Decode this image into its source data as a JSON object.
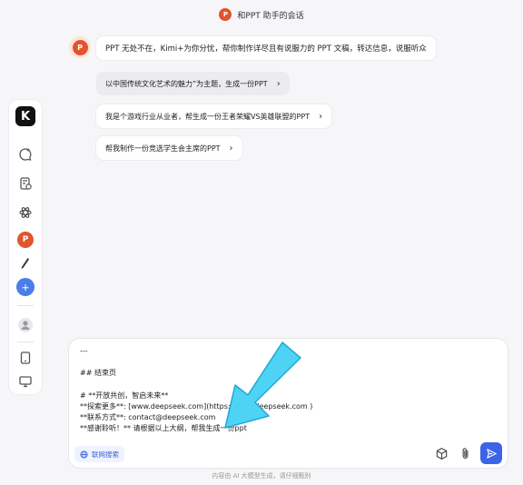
{
  "header": {
    "icon": "ppt-icon",
    "title": "和PPT 助手的会话"
  },
  "assistant": {
    "avatar_label": "P",
    "greeting": "PPT 无处不在，Kimi+为你分忧，帮你制作详尽且有说服力的 PPT 文稿，转达信息，说服听众"
  },
  "suggestions": [
    {
      "text": "以中国传统文化艺术的魅力”为主题，生成一份PPT"
    },
    {
      "text": "我是个游戏行业从业者，帮生成一份王者荣耀VS英雄联盟的PPT"
    },
    {
      "text": "帮我制作一份竞选学生会主席的PPT"
    }
  ],
  "sidebar": {
    "logo": "K",
    "items": [
      "new-chat-icon",
      "history-icon",
      "explore-icon",
      "ppt-icon",
      "pen-icon",
      "kimi-plus-icon",
      "user-icon",
      "tablet-icon",
      "monitor-icon"
    ]
  },
  "input": {
    "text": "---\n\n## 结束页\n\n# **开放共创，智启未来**\n**探索更多**: [www.deepseek.com](https://www.deepseek.com )\n**联系方式**: contact@deepseek.com\n**感谢聆听！** 请根据以上大纲，帮我生成一份ppt",
    "web_search_label": "联网搜索"
  },
  "footer": {
    "text": "内容由 AI 大模型生成，请仔细甄别"
  },
  "colors": {
    "accent": "#3d63e8",
    "annotation_arrow": "#4fd3f5",
    "ppt": "#e0552e"
  }
}
